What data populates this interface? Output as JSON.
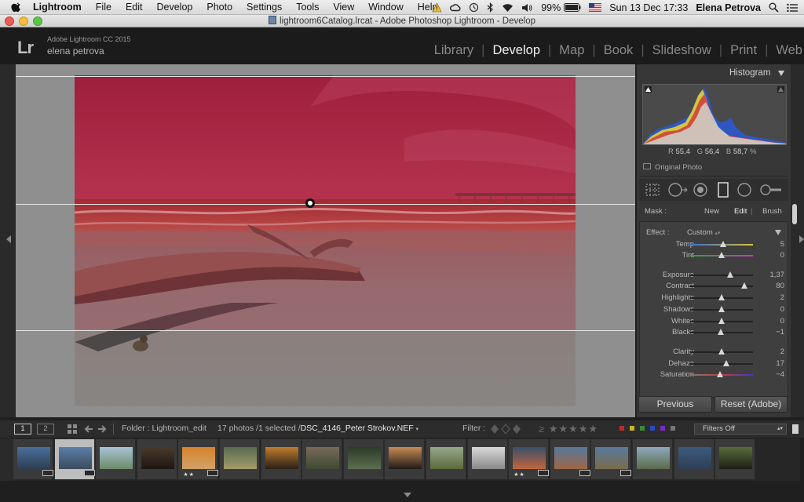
{
  "menubar": {
    "items": [
      "Lightroom",
      "File",
      "Edit",
      "Develop",
      "Photo",
      "Settings",
      "Tools",
      "View",
      "Window",
      "Help"
    ],
    "battery": "99%",
    "datetime": "Sun 13 Dec  17:33",
    "user": "Elena Petrova"
  },
  "window": {
    "title": "lightroom6Catalog.lrcat - Adobe Photoshop Lightroom - Develop"
  },
  "identity": {
    "logo": "Lr",
    "version": "Adobe Lightroom CC 2015",
    "user": "elena petrova"
  },
  "modules": [
    "Library",
    "Develop",
    "Map",
    "Book",
    "Slideshow",
    "Print",
    "Web"
  ],
  "active_module": "Develop",
  "histogram": {
    "title": "Histogram",
    "r_label": "R",
    "r": "55,4",
    "g_label": "G",
    "g": "56,4",
    "b_label": "B",
    "b": "58,7",
    "unit": "%",
    "original_photo": "Original Photo"
  },
  "mask": {
    "label": "Mask :",
    "new": "New",
    "edit": "Edit",
    "brush": "Brush"
  },
  "effect": {
    "label": "Effect :",
    "value": "Custom"
  },
  "sliders": [
    {
      "label": "Temp",
      "value": "5",
      "pos": 0.52,
      "type": "temp"
    },
    {
      "label": "Tint",
      "value": "0",
      "pos": 0.5,
      "type": "tint"
    },
    {
      "label": "Exposure",
      "value": "1,37",
      "pos": 0.64,
      "type": "plain"
    },
    {
      "label": "Contrast",
      "value": "80",
      "pos": 0.86,
      "type": "plain"
    },
    {
      "label": "Highlights",
      "value": "2",
      "pos": 0.5,
      "type": "plain"
    },
    {
      "label": "Shadows",
      "value": "0",
      "pos": 0.5,
      "type": "plain"
    },
    {
      "label": "Whites",
      "value": "0",
      "pos": 0.5,
      "type": "plain"
    },
    {
      "label": "Blacks",
      "value": "−1",
      "pos": 0.49,
      "type": "plain"
    },
    {
      "label": "Clarity",
      "value": "2",
      "pos": 0.5,
      "type": "plain"
    },
    {
      "label": "Dehaze",
      "value": "17",
      "pos": 0.58,
      "type": "plain"
    },
    {
      "label": "Saturation",
      "value": "−4",
      "pos": 0.48,
      "type": "sat"
    }
  ],
  "buttons": {
    "previous": "Previous",
    "reset": "Reset (Adobe)"
  },
  "filmbar": {
    "view1": "1",
    "view2": "2",
    "folder": "Folder : Lightroom_edit",
    "count": "17 photos /1 selected /",
    "filename": "DSC_4146_Peter Strokov.NEF",
    "filter_label": "Filter :",
    "filter_value": "Filters Off"
  },
  "thumbnails": [
    {
      "colors": [
        "#4a6f9a",
        "#2e3e52"
      ],
      "stars": "",
      "badge": true
    },
    {
      "colors": [
        "#5a7fa8",
        "#3b4b5c"
      ],
      "stars": "",
      "badge": true,
      "selected": true
    },
    {
      "colors": [
        "#a9c3d5",
        "#6b8a66"
      ],
      "stars": ""
    },
    {
      "colors": [
        "#4a3a2a",
        "#1d1611"
      ],
      "stars": ""
    },
    {
      "colors": [
        "#d7822c",
        "#d1a268"
      ],
      "stars": "★★",
      "badge": true
    },
    {
      "colors": [
        "#596a4f",
        "#a39c6a"
      ],
      "stars": ""
    },
    {
      "colors": [
        "#c07b2e",
        "#2a2018"
      ],
      "stars": ""
    },
    {
      "colors": [
        "#7a6a5b",
        "#3d4a32"
      ],
      "stars": ""
    },
    {
      "colors": [
        "#2d3a2a",
        "#5b6f4f"
      ],
      "stars": ""
    },
    {
      "colors": [
        "#c68b55",
        "#1f1a16"
      ],
      "stars": ""
    },
    {
      "colors": [
        "#96a78a",
        "#5b6b3b"
      ],
      "stars": ""
    },
    {
      "colors": [
        "#d9d9d9",
        "#888888"
      ],
      "stars": ""
    },
    {
      "colors": [
        "#38506a",
        "#c3643d"
      ],
      "stars": "★★",
      "badge": true
    },
    {
      "colors": [
        "#58779a",
        "#9e6646"
      ],
      "stars": "",
      "badge": true
    },
    {
      "colors": [
        "#587a9c",
        "#7a6a4b"
      ],
      "stars": "",
      "badge": true
    },
    {
      "colors": [
        "#8ea9bd",
        "#5b6b4a"
      ],
      "stars": ""
    },
    {
      "colors": [
        "#3d5b7c",
        "#2e3f56"
      ],
      "stars": ""
    },
    {
      "colors": [
        "#5a6c3b",
        "#1c1f14"
      ],
      "stars": ""
    }
  ]
}
